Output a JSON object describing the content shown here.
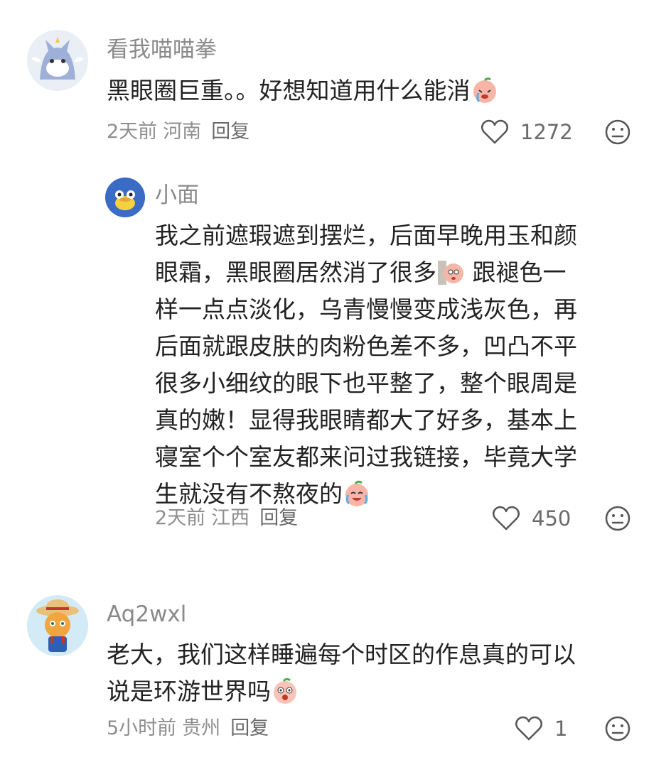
{
  "comments": [
    {
      "username": "看我喵喵拳",
      "text": "黑眼圈巨重。。好想知道用什么能消",
      "time": "2天前",
      "region": "河南",
      "reply_label": "回复",
      "likes": "1272",
      "avatar_icon": "cat-avatar",
      "emoji": "crying-peach-emoji"
    },
    {
      "username": "小面",
      "text_lines": [
        "我之前遮瑕遮到摆烂，后面早晚用玉和颜",
        "眼霜，黑眼圈居然消了很多",
        "样一点点淡化，乌青慢慢变成浅灰色，再",
        "后面就跟皮肤的肉粉色差不多，凹凸不平",
        "很多小细纹的眼下也平整了，整个眼周是",
        "真的嫩！显得我眼睛都大了好多，基本上",
        "寝室个个室友都来问过我链接，毕竟大学",
        "生就没有不熬夜的"
      ],
      "line2_suffix": " 跟褪色一",
      "time": "2天前",
      "region": "江西",
      "reply_label": "回复",
      "likes": "450",
      "avatar_icon": "duck-avatar",
      "emojis": [
        "wall-peek-emoji",
        "crying-laugh-peach-emoji"
      ]
    },
    {
      "username": "Aq2wxl",
      "text_lines": [
        "老大，我们这样睡遍每个时区的作息真的可以",
        "说是环游世界吗"
      ],
      "time": "5小时前",
      "region": "贵州",
      "reply_label": "回复",
      "likes": "1",
      "avatar_icon": "farmer-cat-avatar",
      "emoji": "shocked-peach-emoji"
    }
  ],
  "icons": {
    "like": "heart-outline-icon",
    "dislike": "neutral-face-icon"
  },
  "colors": {
    "username": "#8a8a8a",
    "meta": "#8e8e8e",
    "text": "#222222"
  }
}
